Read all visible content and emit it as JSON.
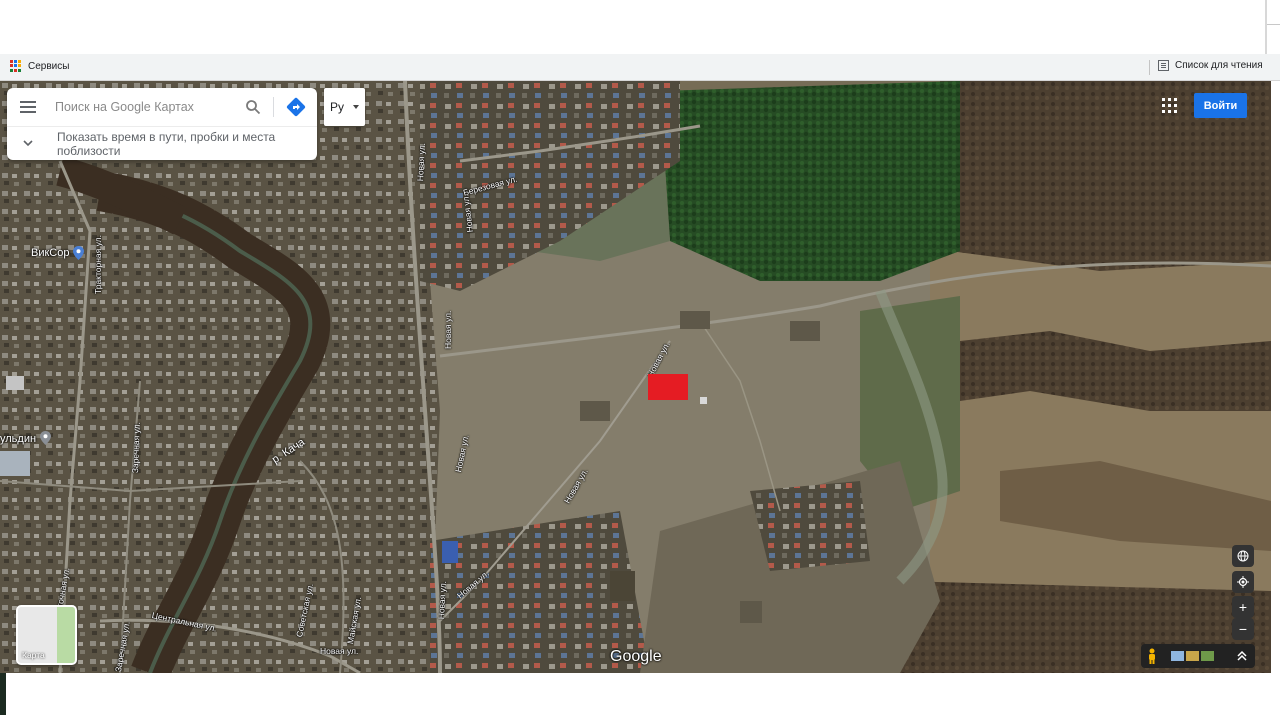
{
  "browser": {
    "bookmarks_bar": {
      "apps_label": "Сервисы",
      "reading_list_label": "Список для чтения"
    }
  },
  "maps": {
    "search": {
      "placeholder": "Поиск на Google Картах",
      "menu_icon": "hamburger-menu-icon",
      "search_icon": "magnifier-icon",
      "directions_icon": "directions-icon"
    },
    "travel_times_hint": "Показать время в пути, пробки и места поблизости",
    "language_select": {
      "value": "Ру"
    },
    "header": {
      "signin_label": "Войти",
      "apps_icon": "apps-grid-icon"
    },
    "layer_toggle": {
      "label": "Карта"
    },
    "logo": "Google",
    "controls": {
      "globe_icon": "globe-icon",
      "location_icon": "my-location-icon",
      "zoom_in": "+",
      "zoom_out": "−"
    }
  },
  "map_labels": {
    "streets": {
      "novaya_1": "Новая ул.",
      "berezovaya": "Березовая ул.",
      "novaya_2": "Новая ул.",
      "traktornaya": "Тракторная ул.",
      "novaya_3": "Новая ул.",
      "novaya_4": "Новая ул.",
      "novaya_5": "Новая ул.",
      "zarechnaya_1": "Заречная ул.",
      "novaya_6": "Новая ул.",
      "novaya_7": "Новая ул.",
      "novaya_8": "Новая ул.",
      "sovetskaya": "Советская ул.",
      "mayskaya": "Майская ул.",
      "tsentralnaya": "Центральная ул.",
      "zarechnaya_2": "Заречная ул.",
      "novaya_9": "Новая ул.",
      "vostochnaya": "Восточная ул."
    },
    "places": {
      "vikcor": "ВикСор",
      "kuldin": "ульдин"
    },
    "river": "р. Кача"
  },
  "colors": {
    "marker": "#e51c23",
    "signin_button": "#1a73e8"
  }
}
